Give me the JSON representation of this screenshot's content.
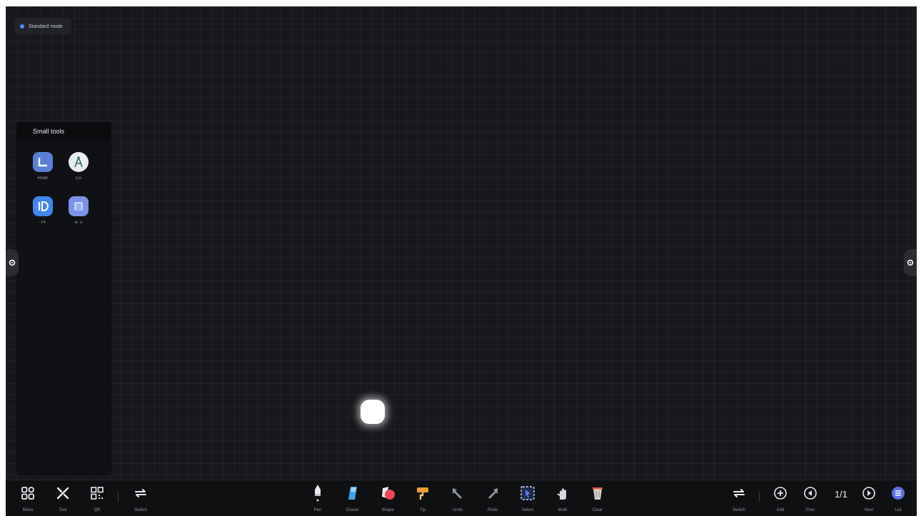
{
  "mode_badge": {
    "label": "Standard mode",
    "accent": "#4a8cf7"
  },
  "small_tools": {
    "title": "Small tools",
    "items": [
      {
        "label": "Ruler",
        "icon": "ruler-icon",
        "color": "#5b7fd6"
      },
      {
        "label": "Co",
        "icon": "compass-icon",
        "color": "#e9ecf1"
      },
      {
        "label": "· Pr·",
        "icon": "protractor-icon",
        "color": "#3f86ee"
      },
      {
        "label": "·a· s·",
        "icon": "calculator-icon",
        "color": "#7c92e8"
      }
    ]
  },
  "side_handles": {
    "left_icon": "gear-icon",
    "right_icon": "gear-icon"
  },
  "toolbar": {
    "left": [
      {
        "label": "Menu",
        "icon": "grid-menu-icon"
      },
      {
        "label": "Tool",
        "icon": "tools-icon"
      },
      {
        "label": "QR",
        "icon": "qr-code-icon"
      },
      {
        "label": "Switch",
        "icon": "switch-icon"
      }
    ],
    "center": [
      {
        "label": "Pen",
        "icon": "pen-icon",
        "color": "#e8eaee"
      },
      {
        "label": "Eraser",
        "icon": "eraser-icon",
        "color": "#3fa2ee"
      },
      {
        "label": "Shape",
        "icon": "shape-icon",
        "color": "#e8485a"
      },
      {
        "label": "Tip",
        "icon": "roller-icon",
        "color": "#f39a2a"
      },
      {
        "label": "Undo",
        "icon": "undo-arrow-icon",
        "color": "#8e929a"
      },
      {
        "label": "Redo",
        "icon": "redo-arrow-icon",
        "color": "#8e929a"
      },
      {
        "label": "Select",
        "icon": "select-icon",
        "color": "#5d7de8"
      },
      {
        "label": "Multi",
        "icon": "multi-touch-icon",
        "color": "#d6d8dd"
      },
      {
        "label": "Clear",
        "icon": "trash-icon",
        "color": "#d8d0c8"
      }
    ],
    "right": [
      {
        "label": "Switch",
        "icon": "switch-icon"
      },
      {
        "label": "Add",
        "icon": "add-page-icon"
      },
      {
        "label": "Prev",
        "icon": "prev-page-icon"
      },
      {
        "label": "Next",
        "icon": "next-page-icon"
      },
      {
        "label": "List",
        "icon": "page-list-icon"
      }
    ],
    "page_indicator": "1/1"
  }
}
